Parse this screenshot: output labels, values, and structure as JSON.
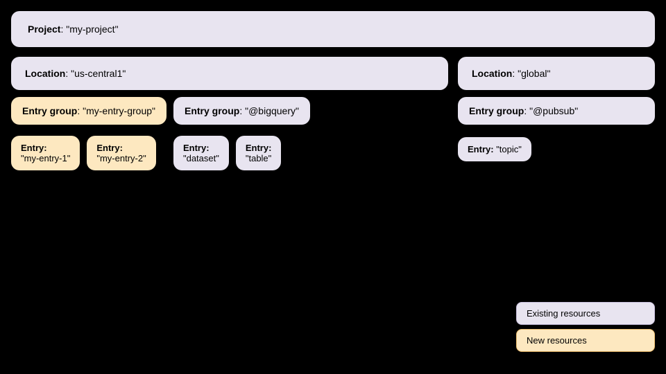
{
  "project": {
    "label": "Project",
    "value": "\"my-project\""
  },
  "locations": [
    {
      "id": "us-central1",
      "label": "Location",
      "value": "\"us-central1\"",
      "entry_groups": [
        {
          "id": "my-entry-group",
          "label": "Entry group",
          "value": "\"my-entry-group\"",
          "style": "orange",
          "entries": [
            {
              "label": "Entry",
              "value": "\"my-entry-1\"",
              "style": "orange"
            },
            {
              "label": "Entry",
              "value": "\"my-entry-2\"",
              "style": "orange"
            }
          ]
        },
        {
          "id": "bigquery",
          "label": "Entry group",
          "value": "\"@bigquery\"",
          "style": "purple",
          "entries": [
            {
              "label": "Entry",
              "value": "\"dataset\"",
              "style": "purple"
            },
            {
              "label": "Entry",
              "value": "\"table\"",
              "style": "purple"
            }
          ]
        }
      ]
    },
    {
      "id": "global",
      "label": "Location",
      "value": "\"global\"",
      "entry_groups": [
        {
          "id": "pubsub",
          "label": "Entry group",
          "value": "\"@pubsub\"",
          "style": "purple",
          "entries": [
            {
              "label": "Entry",
              "value": "\"topic\"",
              "style": "purple"
            }
          ]
        }
      ]
    }
  ],
  "legend": {
    "existing_label": "Existing resources",
    "new_label": "New resources"
  }
}
